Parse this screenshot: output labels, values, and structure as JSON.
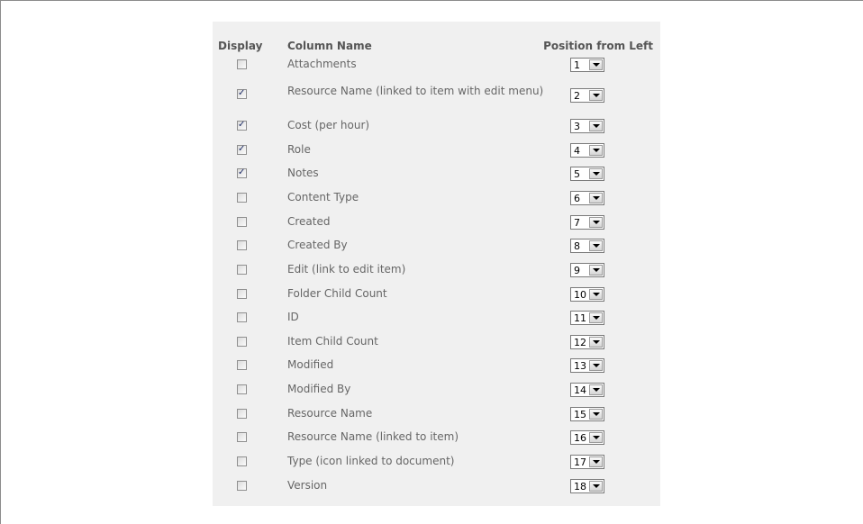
{
  "headers": {
    "display": "Display",
    "column_name": "Column Name",
    "position": "Position from Left"
  },
  "rows": [
    {
      "label": "Attachments",
      "checked": false,
      "position": "1"
    },
    {
      "label": "Resource Name (linked to item with edit menu)",
      "checked": true,
      "position": "2"
    },
    {
      "label": "Cost (per hour)",
      "checked": true,
      "position": "3"
    },
    {
      "label": "Role",
      "checked": true,
      "position": "4"
    },
    {
      "label": "Notes",
      "checked": true,
      "position": "5"
    },
    {
      "label": "Content Type",
      "checked": false,
      "position": "6"
    },
    {
      "label": "Created",
      "checked": false,
      "position": "7"
    },
    {
      "label": "Created By",
      "checked": false,
      "position": "8"
    },
    {
      "label": "Edit (link to edit item)",
      "checked": false,
      "position": "9"
    },
    {
      "label": "Folder Child Count",
      "checked": false,
      "position": "10"
    },
    {
      "label": "ID",
      "checked": false,
      "position": "11"
    },
    {
      "label": "Item Child Count",
      "checked": false,
      "position": "12"
    },
    {
      "label": "Modified",
      "checked": false,
      "position": "13"
    },
    {
      "label": "Modified By",
      "checked": false,
      "position": "14"
    },
    {
      "label": "Resource Name",
      "checked": false,
      "position": "15"
    },
    {
      "label": "Resource Name (linked to item)",
      "checked": false,
      "position": "16"
    },
    {
      "label": "Type (icon linked to document)",
      "checked": false,
      "position": "17"
    },
    {
      "label": "Version",
      "checked": false,
      "position": "18"
    }
  ]
}
